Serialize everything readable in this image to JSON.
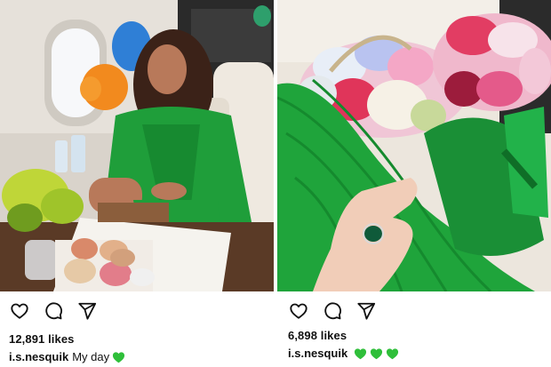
{
  "posts": [
    {
      "likes": "12,891 likes",
      "username": "i.s.nesquik",
      "caption_text": "My day",
      "caption_emojis": [
        "green-heart"
      ]
    },
    {
      "likes": "6,898 likes",
      "username": "i.s.nesquik",
      "caption_text": "",
      "caption_emojis": [
        "green-heart",
        "green-heart",
        "green-heart"
      ]
    }
  ],
  "icons": {
    "like": "heart-outline-icon",
    "comment": "comment-bubble-icon",
    "share": "paper-plane-icon",
    "emoji": "green-heart-emoji"
  },
  "colors": {
    "dress_green": "#1f9e3a",
    "emoji_green": "#2fbf3a",
    "text": "#111111"
  }
}
